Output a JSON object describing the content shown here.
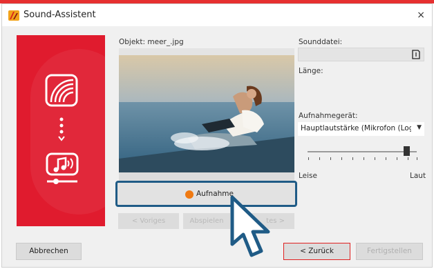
{
  "window": {
    "title": "Sound-Assistent",
    "close_label": "×"
  },
  "object": {
    "label": "Objekt: meer_.jpg"
  },
  "sound": {
    "file_label": "Sounddatei:",
    "length_label": "Länge:",
    "device_label": "Aufnahmegerät:",
    "device_value": "Hauptlautstärke (Mikrofon (Logitec",
    "volume_low": "Leise",
    "volume_high": "Laut",
    "volume_level": 0.92
  },
  "record": {
    "label": "Aufnahme"
  },
  "nav": {
    "prev_label": "< Voriges",
    "play_label": "Abspielen",
    "next_label": "tes >"
  },
  "footer": {
    "cancel_label": "Abbrechen",
    "back_label": "< Zurück",
    "finish_label": "Fertigstellen"
  },
  "colors": {
    "accent_red": "#e01b2e",
    "highlight_blue": "#1f5b86",
    "record_orange": "#f07a12"
  }
}
